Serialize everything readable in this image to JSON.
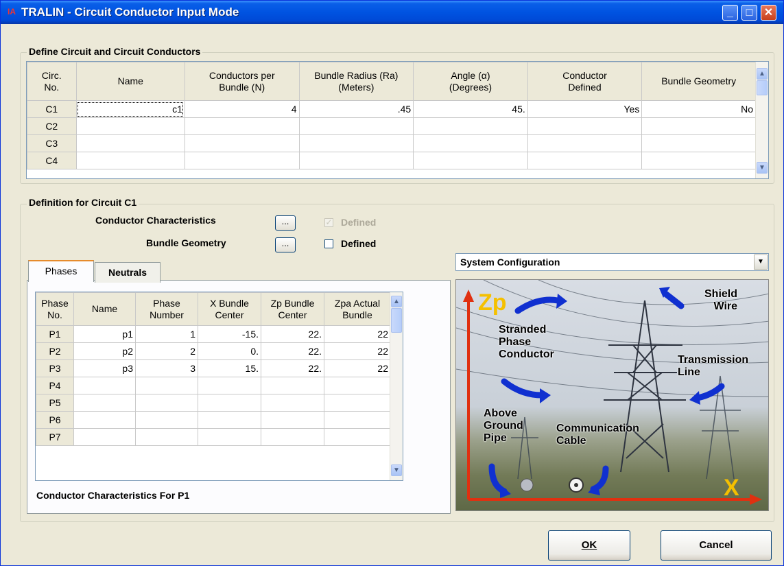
{
  "window": {
    "title": "TRALIN - Circuit Conductor Input Mode",
    "app_icon": "IA"
  },
  "circuits_group": {
    "legend": "Define Circuit and Circuit Conductors",
    "headers": [
      "Circ.\nNo.",
      "Name",
      "Conductors per\nBundle (N)",
      "Bundle Radius (Ra)\n(Meters)",
      "Angle (α)\n(Degrees)",
      "Conductor\nDefined",
      "Bundle Geometry"
    ],
    "rows": [
      [
        "C1",
        "c1",
        "4",
        ".45",
        "45.",
        "Yes",
        "No"
      ],
      [
        "C2",
        "",
        "",
        "",
        "",
        "",
        ""
      ],
      [
        "C3",
        "",
        "",
        "",
        "",
        "",
        ""
      ],
      [
        "C4",
        "",
        "",
        "",
        "",
        "",
        ""
      ]
    ]
  },
  "definition_group": {
    "legend": "Definition for Circuit C1",
    "conductor_characteristics_label": "Conductor Characteristics",
    "bundle_geometry_label": "Bundle Geometry",
    "ellipsis": "...",
    "defined_label": "Defined",
    "conductor_defined_checked": true,
    "bundle_defined_checked": false,
    "tabs": [
      "Phases",
      "Neutrals"
    ],
    "active_tab": "Phases",
    "phase_headers": [
      "Phase\nNo.",
      "Name",
      "Phase\nNumber",
      "X Bundle\nCenter",
      "Zp Bundle\nCenter",
      "Zpa Actual\nBundle"
    ],
    "phase_rows": [
      [
        "P1",
        "p1",
        "1",
        "-15.",
        "22.",
        "22"
      ],
      [
        "P2",
        "p2",
        "2",
        "0.",
        "22.",
        "22"
      ],
      [
        "P3",
        "p3",
        "3",
        "15.",
        "22.",
        "22"
      ],
      [
        "P4",
        "",
        "",
        "",
        "",
        ""
      ],
      [
        "P5",
        "",
        "",
        "",
        "",
        ""
      ],
      [
        "P6",
        "",
        "",
        "",
        "",
        ""
      ],
      [
        "P7",
        "",
        "",
        "",
        "",
        ""
      ]
    ],
    "status_text": "Conductor Characteristics For P1"
  },
  "system_config": {
    "selected": "System Configuration",
    "diagram_labels": {
      "zp": "Zp",
      "x": "X",
      "shield_wire": "Shield\nWire",
      "stranded": "Stranded\nPhase\nConductor",
      "transmission": "Transmission\nLine",
      "above_ground": "Above\nGround\nPipe",
      "communication": "Communication\nCable"
    }
  },
  "buttons": {
    "ok": "OK",
    "cancel": "Cancel"
  },
  "colors": {
    "title_bar": "#0053e1",
    "window_bg": "#ece9d8",
    "arrow_blue": "#1030d0",
    "axis_red": "#e03010",
    "axis_label_yellow": "#f5c000"
  }
}
